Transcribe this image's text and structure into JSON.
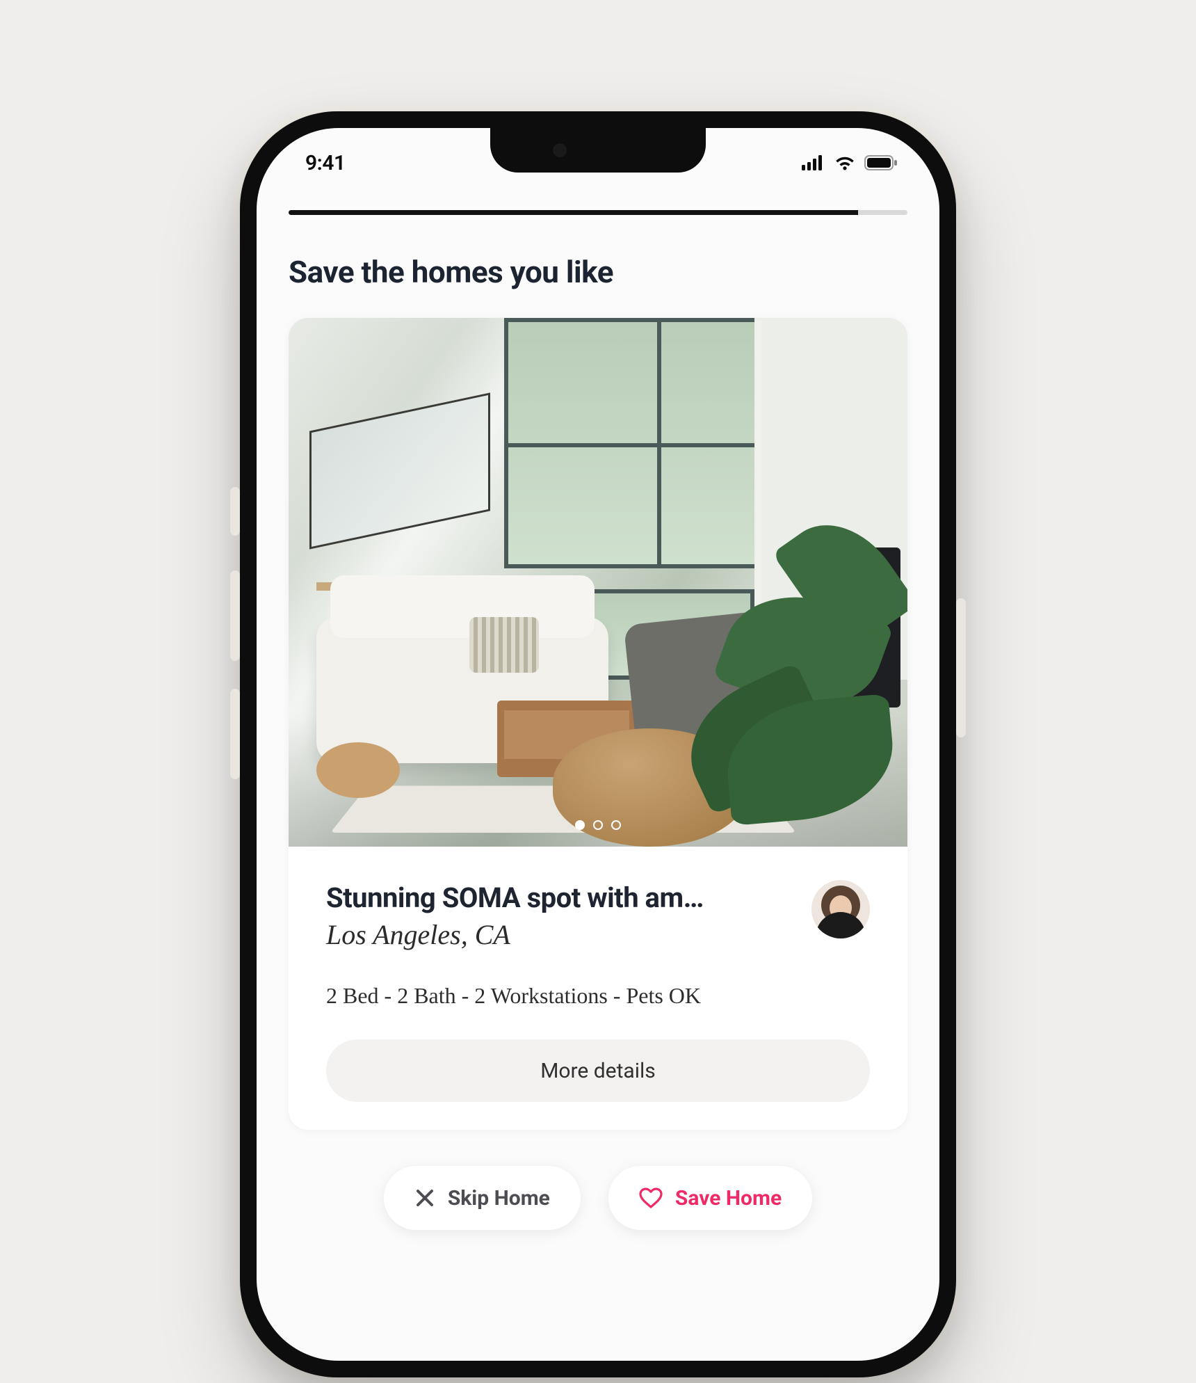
{
  "status": {
    "time": "9:41"
  },
  "progress": {
    "percent": 92
  },
  "heading": "Save the homes you like",
  "listing": {
    "title": "Stunning SOMA spot with am…",
    "location": "Los Angeles, CA",
    "meta": "2 Bed - 2 Bath - 2 Workstations - Pets OK",
    "details_label": "More details",
    "carousel": {
      "count": 3,
      "active_index": 0
    }
  },
  "actions": {
    "skip_label": "Skip Home",
    "save_label": "Save Home"
  },
  "colors": {
    "accent": "#ee2b66",
    "text_primary": "#1c2431"
  }
}
